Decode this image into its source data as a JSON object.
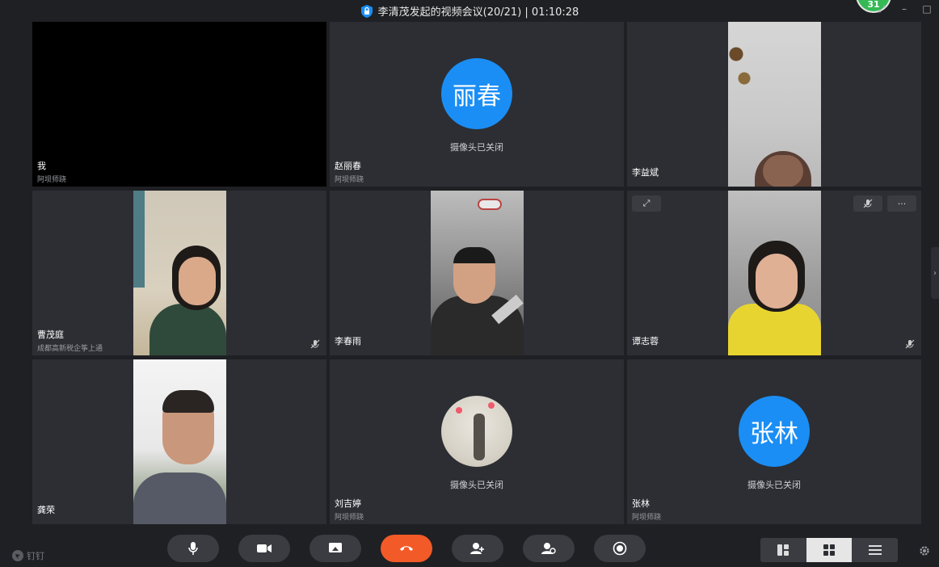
{
  "window": {
    "title": "李清茂发起的视频会议(20/21) | 01:10:28",
    "badge_count": "31"
  },
  "tiles": [
    {
      "name": "我",
      "sub": "阿坝师跷"
    },
    {
      "name": "赵丽春",
      "sub": "阿坝师跷",
      "avatar_text": "丽春",
      "camera_status": "摄像头已关闭"
    },
    {
      "name": "李益斌"
    },
    {
      "name": "曹茂庭",
      "sub": "成都高新税企筝上通"
    },
    {
      "name": "李春雨"
    },
    {
      "name": "谭志蓉"
    },
    {
      "name": "龚荣"
    },
    {
      "name": "刘吉婷",
      "sub": "阿坝师跷",
      "camera_status": "摄像头已关闭"
    },
    {
      "name": "张林",
      "sub": "阿坝师跷",
      "avatar_text": "张林",
      "camera_status": "摄像头已关闭"
    }
  ],
  "footer": {
    "logo_text": "钉钉"
  },
  "colors": {
    "background": "#1f2024",
    "tile": "#2c2e33",
    "avatar": "#1a8ef5",
    "hangup": "#f25a27",
    "badge": "#34b955"
  }
}
